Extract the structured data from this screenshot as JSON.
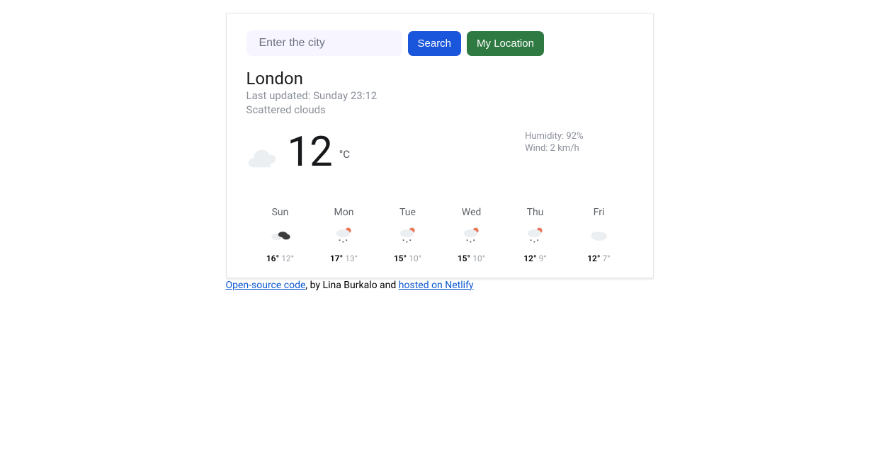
{
  "search": {
    "placeholder": "Enter the city",
    "search_label": "Search",
    "location_label": "My Location"
  },
  "current": {
    "city": "London",
    "last_updated": "Last updated: Sunday 23:12",
    "description": "Scattered clouds",
    "temp": "12",
    "unit": "°C",
    "humidity": "Humidity: 92%",
    "wind": "Wind: 2 km/h"
  },
  "forecast": [
    {
      "day": "Sun",
      "icon": "broken-clouds",
      "high": "16°",
      "low": "12°"
    },
    {
      "day": "Mon",
      "icon": "rain",
      "high": "17°",
      "low": "13°"
    },
    {
      "day": "Tue",
      "icon": "rain",
      "high": "15°",
      "low": "10°"
    },
    {
      "day": "Wed",
      "icon": "rain",
      "high": "15°",
      "low": "10°"
    },
    {
      "day": "Thu",
      "icon": "rain",
      "high": "12°",
      "low": "9°"
    },
    {
      "day": "Fri",
      "icon": "cloud",
      "high": "12°",
      "low": "7°"
    }
  ],
  "footer": {
    "link1": "Open-source code",
    "mid": ", by Lina Burkalo and ",
    "link2": "hosted on Netlify"
  }
}
